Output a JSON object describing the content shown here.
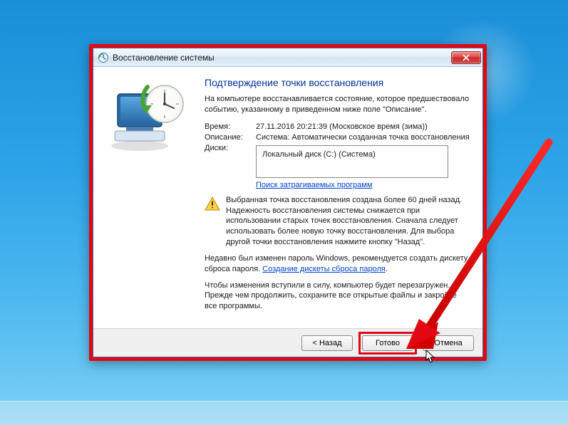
{
  "window": {
    "title": "Восстановление системы"
  },
  "heading": "Подтверждение точки восстановления",
  "intro": "На компьютере восстанавливается состояние, которое предшествовало событию, указанному в приведенном ниже поле \"Описание\".",
  "fields": {
    "time_label": "Время:",
    "time_value": "27.11.2016 20:21:39 (Московское время (зима))",
    "desc_label": "Описание:",
    "desc_value": "Система: Автоматически созданная точка восстановления",
    "disks_label": "Диски:",
    "disks_value": "Локальный диск (C:) (Система)"
  },
  "links": {
    "affected": "Поиск затрагиваемых программ",
    "password_disk": "Создание дискеты сброса пароля"
  },
  "warning": "Выбранная точка восстановления создана более 60 дней назад. Надежность восстановления системы снижается при использовании старых точек восстановления. Сначала следует использовать более новую точку восстановления. Для выбора другой точки восстановления нажмите кнопку \"Назад\".",
  "password_note_prefix": "Недавно был изменен пароль Windows, рекомендуется создать дискету сброса пароля. ",
  "restart_note": "Чтобы изменения вступили в силу, компьютер будет перезагружен. Прежде чем продолжить, сохраните все открытые файлы и закройте все программы.",
  "buttons": {
    "back": "< Назад",
    "finish": "Готово",
    "cancel": "Отмена"
  }
}
